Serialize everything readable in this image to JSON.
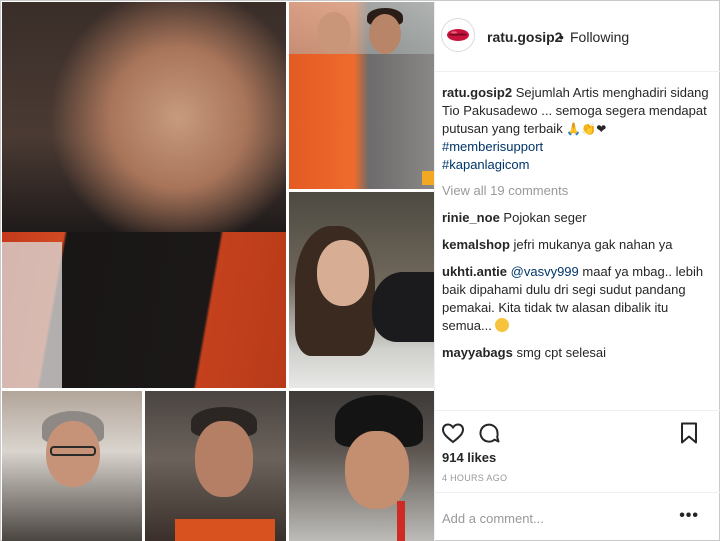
{
  "post": {
    "username": "ratu.gosip2",
    "separator": "•",
    "follow_status": "Following",
    "caption": {
      "user": "ratu.gosip2",
      "text": "Sejumlah Artis menghadiri sidang Tio Pakusadewo ... semoga segera mendapat putusan yang terbaik",
      "emojis": "🙏👏❤",
      "hashtags": [
        "#memberisupport",
        "#kapanlagicom"
      ]
    },
    "view_all_comments": "View all 19 comments",
    "comments": [
      {
        "user": "rinie_noe",
        "text": "Pojokan seger"
      },
      {
        "user": "kemalshop",
        "text": "jefri mukanya gak nahan ya"
      },
      {
        "user": "ukhti.antie",
        "mention": "@vasvy999",
        "text": "maaf ya mbag.. lebih baik dipahami dulu dri segi sudut pandang pemakai. Kita tidak tw alasan dibalik itu semua..."
      },
      {
        "user": "mayyabags",
        "text": "smg cpt selesai"
      }
    ],
    "likes": "914 likes",
    "timestamp": "4 HOURS AGO",
    "add_comment_placeholder": "Add a comment...",
    "more_label": "•••"
  },
  "colors": {
    "link": "#003569",
    "muted": "#999999",
    "text": "#262626",
    "border": "#efefef"
  },
  "icons": [
    "heart-icon",
    "comment-icon",
    "bookmark-icon",
    "more-options-icon",
    "lips-avatar-icon"
  ]
}
